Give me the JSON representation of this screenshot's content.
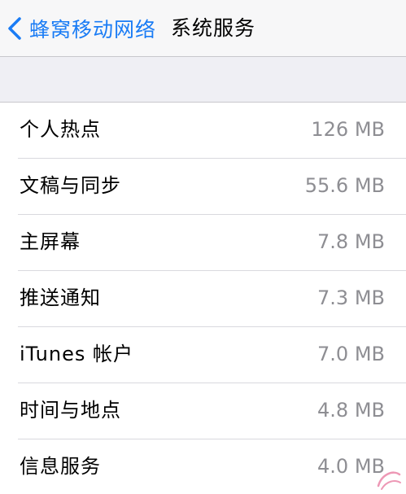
{
  "nav": {
    "back_label": "蜂窝移动网络",
    "title": "系统服务"
  },
  "items": [
    {
      "label": "个人热点",
      "value": "126 MB"
    },
    {
      "label": "文稿与同步",
      "value": "55.6 MB"
    },
    {
      "label": "主屏幕",
      "value": "7.8 MB"
    },
    {
      "label": "推送通知",
      "value": "7.3 MB"
    },
    {
      "label": "iTunes 帐户",
      "value": "7.0 MB"
    },
    {
      "label": "时间与地点",
      "value": "4.8 MB"
    },
    {
      "label": "信息服务",
      "value": "4.0 MB"
    }
  ],
  "colors": {
    "accent": "#1a7cf5",
    "secondary_text": "#8e8e93",
    "group_background": "#efeff4"
  }
}
